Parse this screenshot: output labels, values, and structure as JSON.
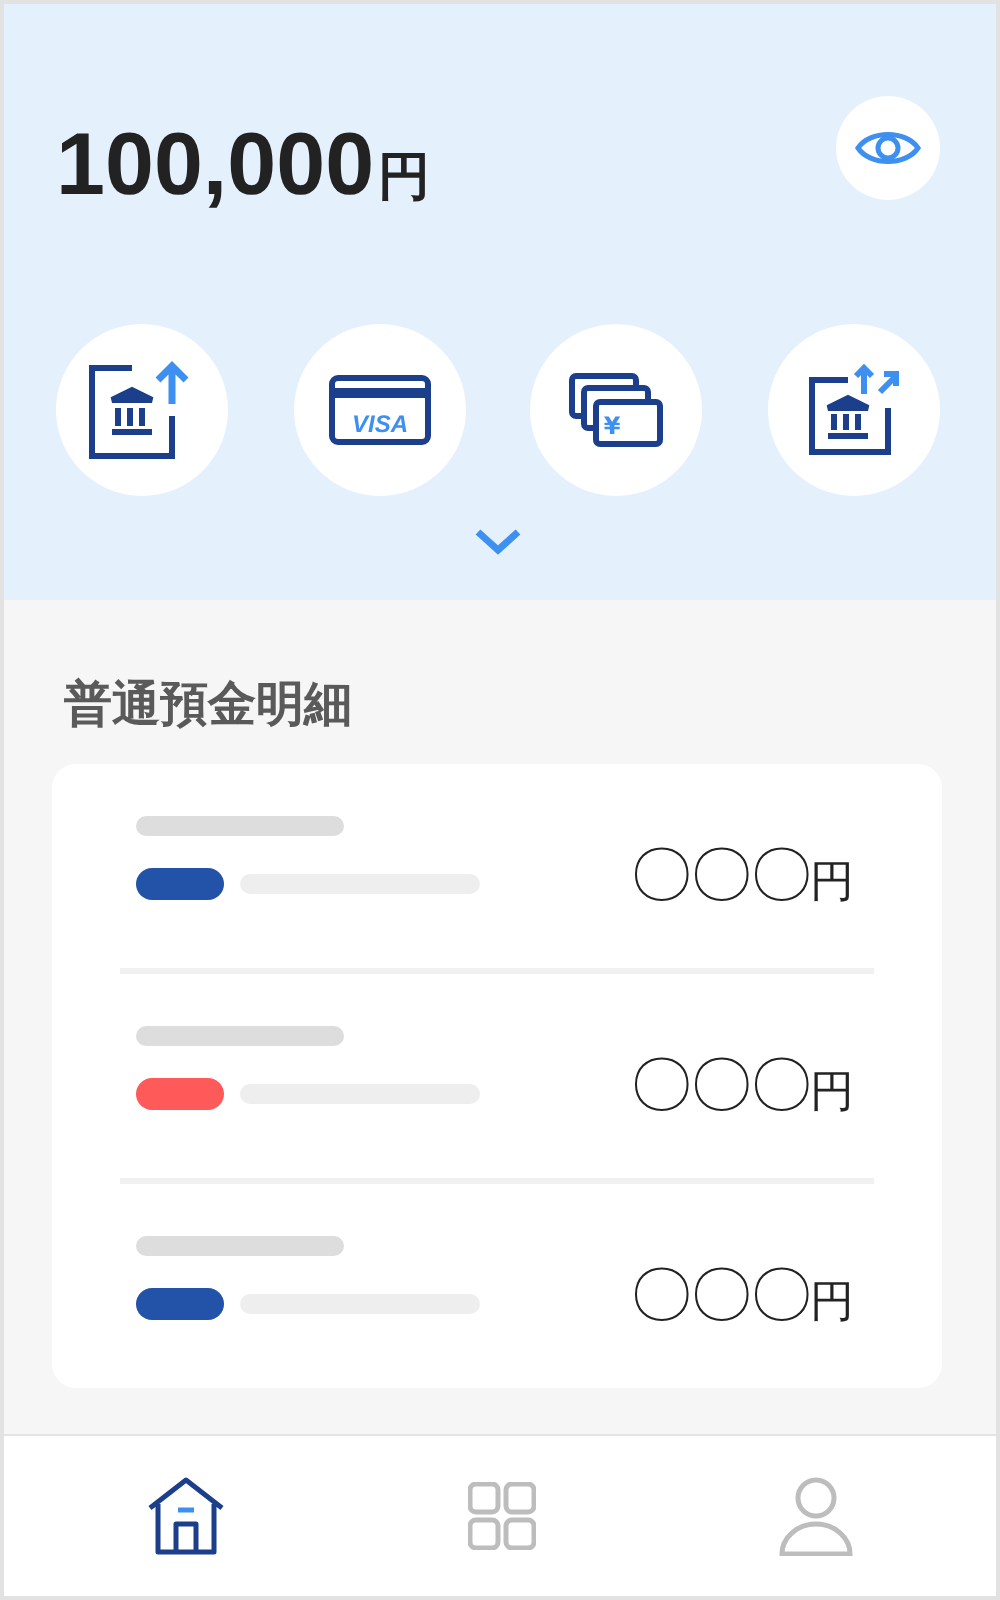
{
  "balance": {
    "amount": "100,000",
    "unit": "円",
    "visible": true
  },
  "actions": [
    {
      "kind": "bank-up"
    },
    {
      "kind": "card",
      "label": "VISA"
    },
    {
      "kind": "cash",
      "label": "¥"
    },
    {
      "kind": "bank-transfer"
    }
  ],
  "section_title": "普通預金明細",
  "transactions": [
    {
      "color": "#2353a8",
      "amount": "〇〇〇",
      "unit": "円"
    },
    {
      "color": "#ff5a5a",
      "amount": "〇〇〇",
      "unit": "円"
    },
    {
      "color": "#2353a8",
      "amount": "〇〇〇",
      "unit": "円"
    }
  ],
  "nav": [
    {
      "kind": "home",
      "selected": true
    },
    {
      "kind": "grid",
      "selected": false
    },
    {
      "kind": "person",
      "selected": false
    }
  ]
}
